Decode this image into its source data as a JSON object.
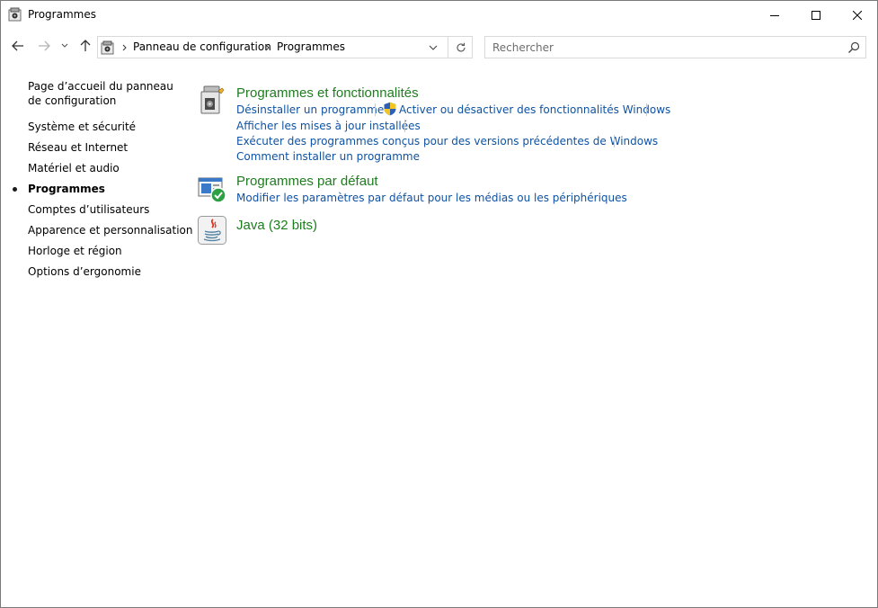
{
  "window": {
    "title": "Programmes"
  },
  "address": {
    "crumbs": [
      "Panneau de configuration",
      "Programmes"
    ]
  },
  "search": {
    "placeholder": "Rechercher"
  },
  "sidebar": {
    "items": [
      {
        "label": "Page d’accueil du panneau de configuration"
      },
      {
        "label": "Système et sécurité"
      },
      {
        "label": "Réseau et Internet"
      },
      {
        "label": "Matériel et audio"
      },
      {
        "label": "Programmes",
        "active": true
      },
      {
        "label": "Comptes d’utilisateurs"
      },
      {
        "label": "Apparence et personnalisation"
      },
      {
        "label": "Horloge et région"
      },
      {
        "label": "Options d’ergonomie"
      }
    ]
  },
  "categories": [
    {
      "title": "Programmes et fonctionnalités",
      "icon": "programs-features-icon",
      "links": [
        "Désinstaller un programme",
        "Activer ou désactiver des fonctionnalités Windows",
        "Afficher les mises à jour installées",
        "Exécuter des programmes conçus pour des versions précédentes de Windows",
        "Comment installer un programme"
      ]
    },
    {
      "title": "Programmes par défaut",
      "icon": "default-programs-icon",
      "links": [
        "Modifier les paramètres par défaut pour les médias ou les périphériques"
      ]
    },
    {
      "title": "Java (32 bits)",
      "icon": "java-icon",
      "links": []
    }
  ],
  "colors": {
    "category_title": "#1e7d1e",
    "link": "#0e52a3"
  }
}
